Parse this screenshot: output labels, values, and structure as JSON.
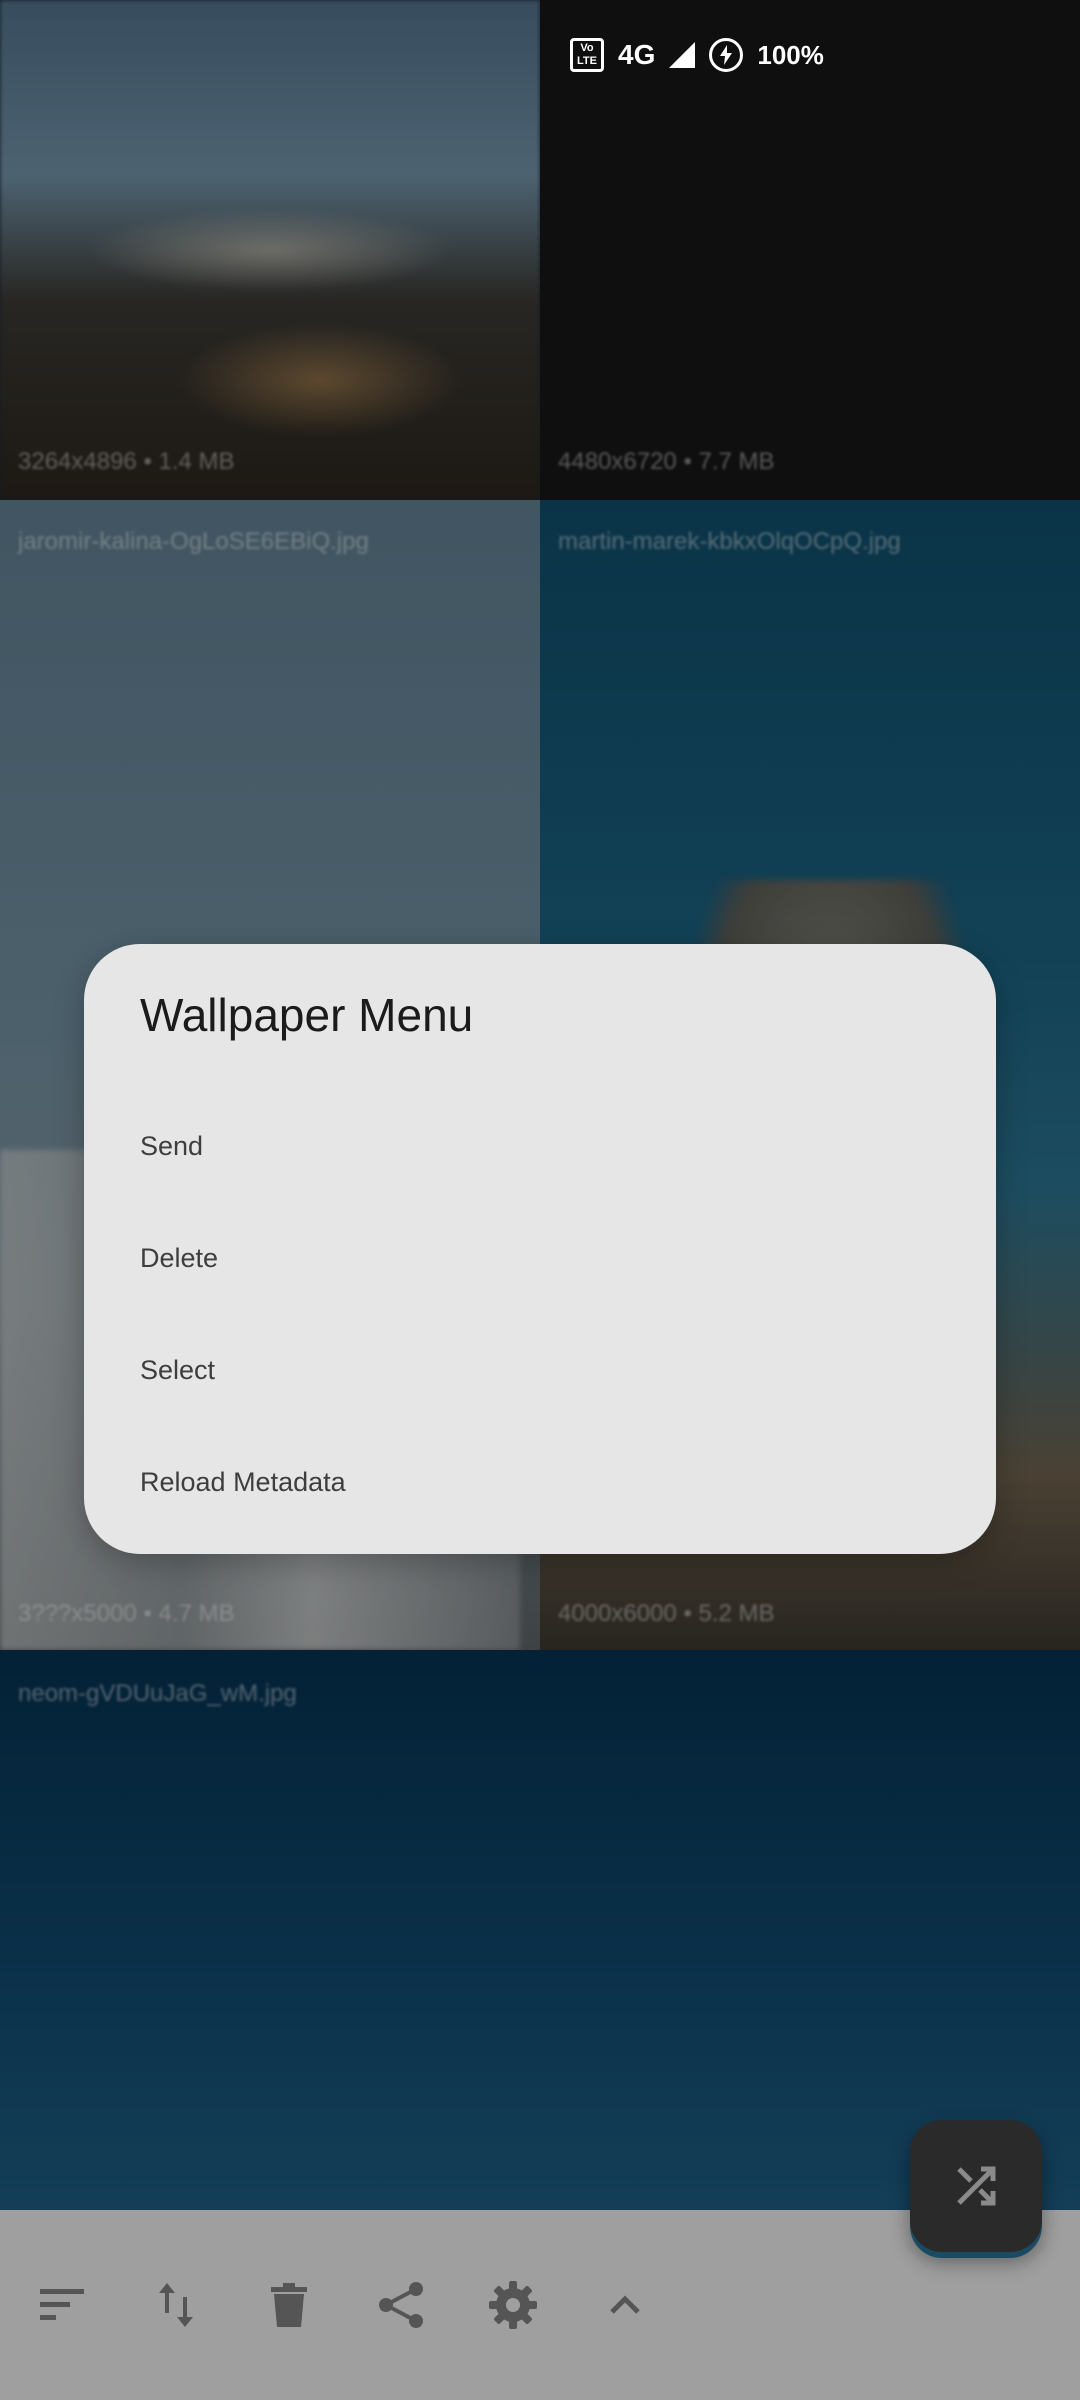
{
  "status_bar": {
    "volte": "Vo LTE",
    "network": "4G",
    "battery": "100%"
  },
  "wallpapers": [
    {
      "meta": "3264x4896 • 1.4 MB",
      "name": ""
    },
    {
      "meta": "4480x6720 • 7.7 MB",
      "name": ""
    },
    {
      "meta": "3???x5000 • 4.7 MB",
      "name": "jaromir-kalina-OgLoSE6EBiQ.jpg"
    },
    {
      "meta": "4000x6000 • 5.2 MB",
      "name": "martin-marek-kbkxOlqOCpQ.jpg"
    },
    {
      "meta": "",
      "name": "neom-gVDUuJaG_wM.jpg"
    }
  ],
  "dialog": {
    "title": "Wallpaper Menu",
    "items": [
      "Send",
      "Delete",
      "Select",
      "Reload Metadata"
    ]
  },
  "bottom_bar": {
    "icons": [
      "sort-icon",
      "swap-vertical-icon",
      "delete-icon",
      "share-icon",
      "settings-icon",
      "expand-up-icon"
    ],
    "fab_icon": "shuffle-icon"
  }
}
